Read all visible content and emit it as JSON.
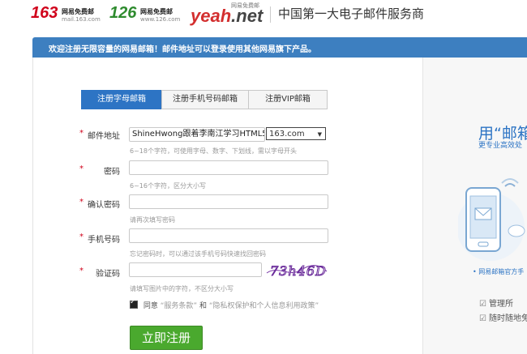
{
  "header": {
    "logo163": {
      "number": "163",
      "line1": "网易免费邮",
      "line2": "mail.163.com"
    },
    "logo126": {
      "number": "126",
      "line1": "网易免费邮",
      "line2": "www.126.com"
    },
    "logoYeah": {
      "text": "yeah",
      "dot": ".",
      "tld": "net",
      "tag": "网易免费邮"
    },
    "slogan": "中国第一大电子邮件服务商"
  },
  "banner": {
    "text": "欢迎注册无限容量的网易邮箱！邮件地址可以登录使用其他网易旗下产品。"
  },
  "tabs": [
    {
      "label": "注册字母邮箱",
      "active": true
    },
    {
      "label": "注册手机号码邮箱",
      "active": false
    },
    {
      "label": "注册VIP邮箱",
      "active": false
    }
  ],
  "form": {
    "email": {
      "label": "邮件地址",
      "value": "ShineHwong跟着李南江学习HTML5-@",
      "domain": "163.com",
      "hint": "6~18个字符，可使用字母、数字、下划线，需以字母开头"
    },
    "password": {
      "label": "密码",
      "value": "",
      "hint": "6~16个字符，区分大小写"
    },
    "confirm": {
      "label": "确认密码",
      "value": "",
      "hint": "请再次填写密码"
    },
    "phone": {
      "label": "手机号码",
      "value": "",
      "hint": "忘记密码时，可以通过该手机号码快速找回密码"
    },
    "captcha": {
      "label": "验证码",
      "value": "",
      "image_text": "73h46D",
      "hint": "请填写图片中的字符，不区分大小写"
    },
    "required_mark": "*",
    "agree": {
      "prefix": "同意",
      "terms": "“服务条款”",
      "and": "和",
      "privacy": "“隐私权保护和个人信息利用政策”",
      "checked": true
    },
    "submit": "立即注册"
  },
  "promo": {
    "title": "用“邮箱",
    "subtitle": "更专业高效处",
    "link": "• 网易邮箱官方手",
    "features": [
      "管理所",
      "随时随地免"
    ]
  },
  "colors": {
    "brand_red": "#d0021b",
    "accent_blue": "#2d74c4",
    "banner_blue": "#3d7fc0",
    "submit_green": "#4aa92e"
  }
}
